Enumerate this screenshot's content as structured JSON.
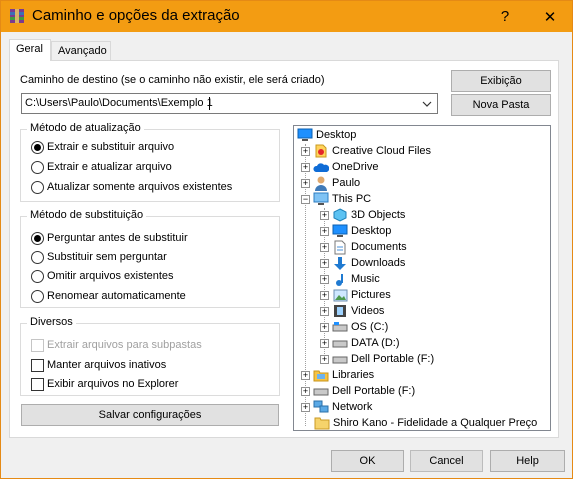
{
  "window": {
    "title": "Caminho e opções da extração",
    "help_glyph": "?",
    "close_glyph": "✕",
    "accent": "#f39c12"
  },
  "tabs": [
    {
      "label": "Geral"
    },
    {
      "label": "Avançado"
    }
  ],
  "destination": {
    "label": "Caminho de destino (se o caminho não existir, ele será criado)",
    "value": "C:\\Users\\Paulo\\Documents\\Exemplo 1"
  },
  "buttons": {
    "show": "Exibição",
    "new_folder": "Nova Pasta",
    "save_settings": "Salvar configurações",
    "ok": "OK",
    "cancel": "Cancel",
    "help": "Help"
  },
  "update_mode": {
    "title": "Método de atualização",
    "options": [
      {
        "label": "Extrair e substituir arquivo",
        "selected": true
      },
      {
        "label": "Extrair e atualizar arquivo",
        "selected": false
      },
      {
        "label": "Atualizar somente arquivos existentes",
        "selected": false
      }
    ]
  },
  "overwrite_mode": {
    "title": "Método de substituição",
    "options": [
      {
        "label": "Perguntar antes de substituir",
        "selected": true
      },
      {
        "label": "Substituir sem perguntar",
        "selected": false
      },
      {
        "label": "Omitir arquivos existentes",
        "selected": false
      },
      {
        "label": "Renomear automaticamente",
        "selected": false
      }
    ]
  },
  "misc": {
    "title": "Diversos",
    "options": [
      {
        "label": "Extrair arquivos para subpastas",
        "checked": false,
        "disabled": true
      },
      {
        "label": "Manter arquivos inativos",
        "checked": false,
        "disabled": false
      },
      {
        "label": "Exibir arquivos no Explorer",
        "checked": false,
        "disabled": false
      }
    ]
  },
  "tree": [
    {
      "label": "Desktop",
      "icon": "desktop-icon",
      "expander": ""
    },
    {
      "label": "Creative Cloud Files",
      "icon": "creative-cloud-icon",
      "expander": "+"
    },
    {
      "label": "OneDrive",
      "icon": "onedrive-icon",
      "expander": "+"
    },
    {
      "label": "Paulo",
      "icon": "user-icon",
      "expander": "+"
    },
    {
      "label": "This PC",
      "icon": "computer-icon",
      "expander": "−"
    },
    {
      "label": "3D Objects",
      "icon": "3d-objects-icon",
      "expander": "+"
    },
    {
      "label": "Desktop",
      "icon": "desktop-icon",
      "expander": "+"
    },
    {
      "label": "Documents",
      "icon": "documents-icon",
      "expander": "+"
    },
    {
      "label": "Downloads",
      "icon": "downloads-icon",
      "expander": "+"
    },
    {
      "label": "Music",
      "icon": "music-icon",
      "expander": "+"
    },
    {
      "label": "Pictures",
      "icon": "pictures-icon",
      "expander": "+"
    },
    {
      "label": "Videos",
      "icon": "videos-icon",
      "expander": "+"
    },
    {
      "label": "OS (C:)",
      "icon": "drive-icon",
      "expander": "+"
    },
    {
      "label": "DATA (D:)",
      "icon": "drive-icon",
      "expander": "+"
    },
    {
      "label": "Dell Portable (F:)",
      "icon": "drive-icon",
      "expander": "+"
    },
    {
      "label": "Libraries",
      "icon": "libraries-icon",
      "expander": "+"
    },
    {
      "label": "Dell Portable (F:)",
      "icon": "drive-icon",
      "expander": "+"
    },
    {
      "label": "Network",
      "icon": "network-icon",
      "expander": "+"
    },
    {
      "label": "Shiro Kano - Fidelidade a Qualquer Preço",
      "icon": "folder-icon",
      "expander": ""
    }
  ]
}
